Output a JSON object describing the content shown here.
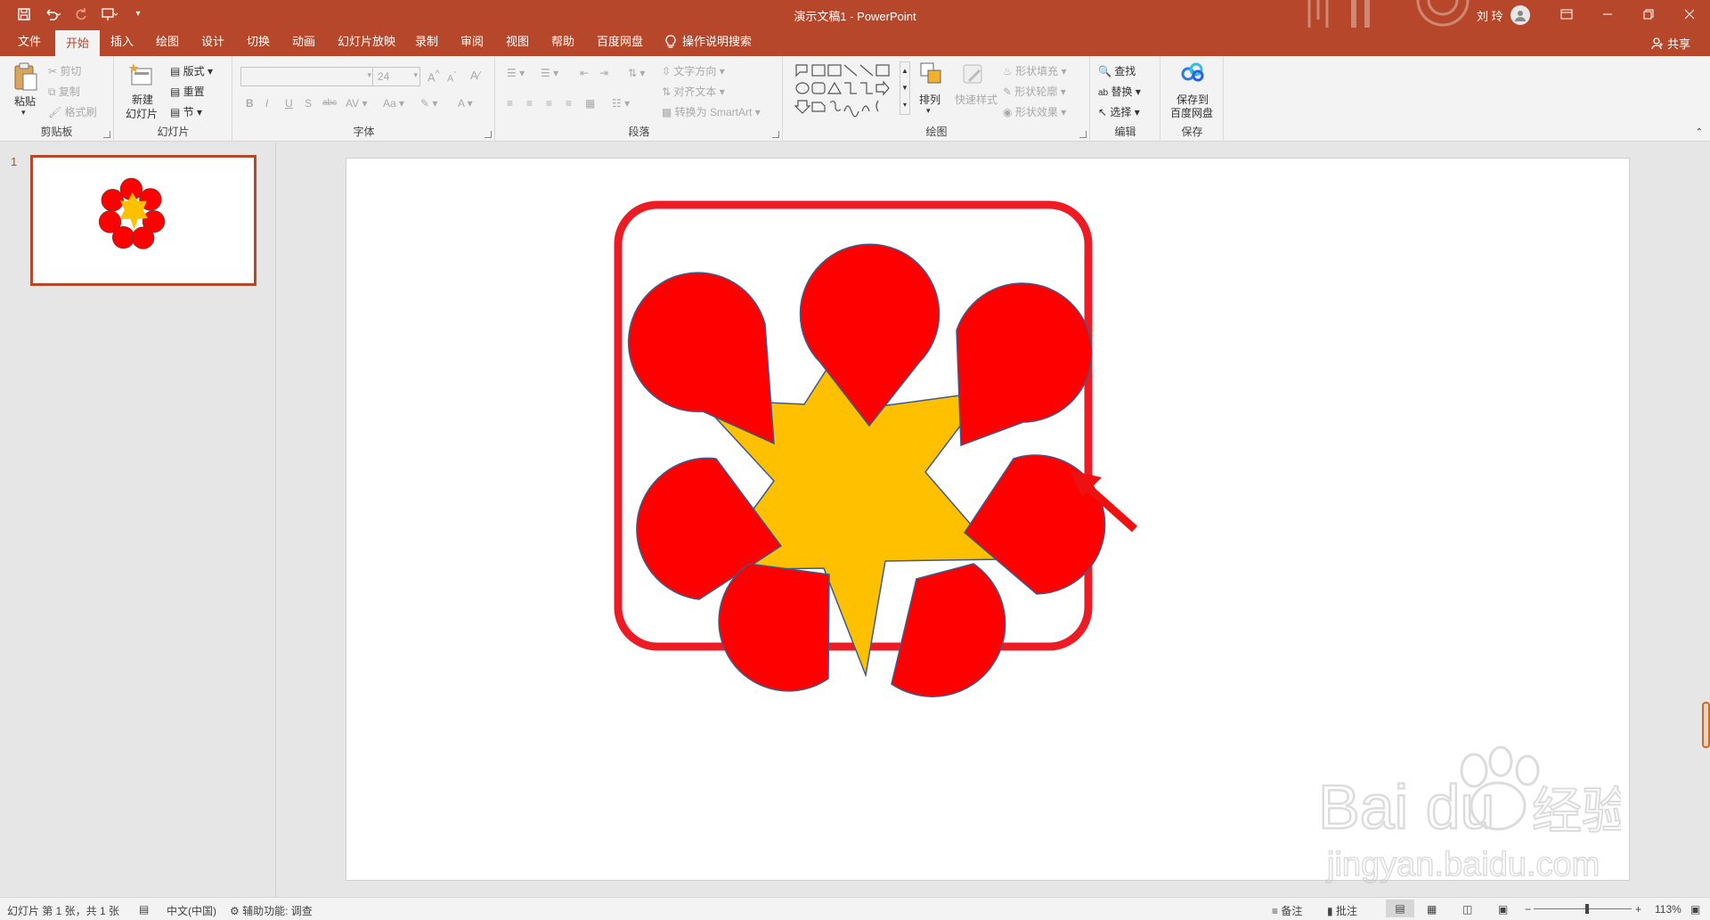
{
  "titlebar": {
    "title": "演示文稿1  -  PowerPoint",
    "user": "刘 玲"
  },
  "tabs": [
    "文件",
    "开始",
    "插入",
    "绘图",
    "设计",
    "切换",
    "动画",
    "幻灯片放映",
    "录制",
    "审阅",
    "视图",
    "帮助",
    "百度网盘"
  ],
  "tell_me": "操作说明搜索",
  "share": "共享",
  "ribbon": {
    "clipboard": {
      "paste": "粘贴",
      "cut": "剪切",
      "copy": "复制",
      "format_painter": "格式刷",
      "label": "剪贴板"
    },
    "slides": {
      "new_slide_1": "新建",
      "new_slide_2": "幻灯片",
      "layout": "版式",
      "reset": "重置",
      "section": "节",
      "label": "幻灯片"
    },
    "font": {
      "size": "24",
      "label": "字体"
    },
    "paragraph": {
      "text_direction": "文字方向",
      "align_text": "对齐文本",
      "smartart": "转换为 SmartArt",
      "label": "段落"
    },
    "drawing": {
      "arrange": "排列",
      "quick_styles": "快速样式",
      "shape_fill": "形状填充",
      "shape_outline": "形状轮廓",
      "shape_effects": "形状效果",
      "label": "绘图"
    },
    "editing": {
      "find": "查找",
      "replace": "替换",
      "select": "选择",
      "label": "编辑"
    },
    "save": {
      "save_to_1": "保存到",
      "save_to_2": "百度网盘",
      "label": "保存"
    }
  },
  "thumbnails": [
    {
      "number": "1"
    }
  ],
  "status": {
    "slide_info": "幻灯片 第 1 张，共 1 张",
    "language": "中文(中国)",
    "accessibility": "辅助功能: 调查",
    "notes": "备注",
    "comments": "批注",
    "zoom": "113%"
  },
  "colors": {
    "accent": "#b7472a",
    "petal": "#ff0000",
    "star": "#ffc000",
    "frame": "#ed1c24"
  },
  "icons": [
    "save-icon",
    "undo-icon",
    "redo-icon",
    "present-icon",
    "lightbulb-icon",
    "share-icon",
    "arrow-icon"
  ]
}
